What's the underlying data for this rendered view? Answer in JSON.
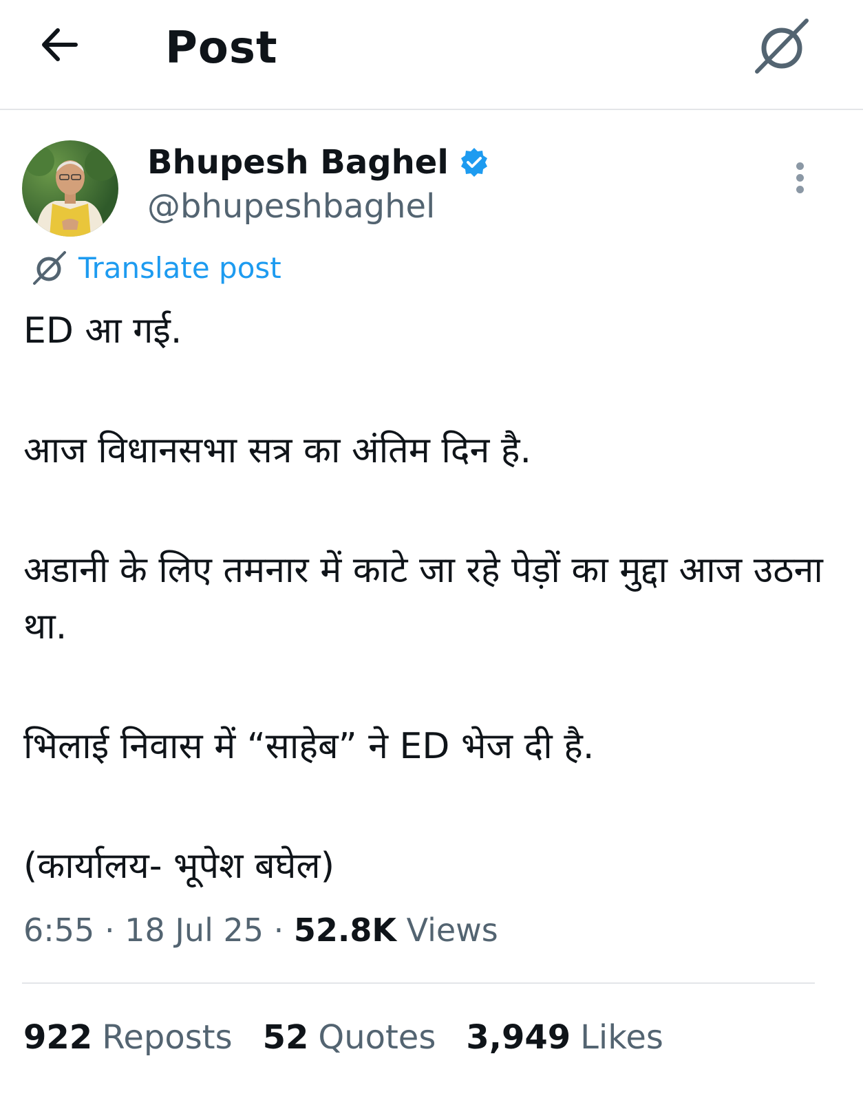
{
  "header": {
    "title": "Post",
    "back_icon": "arrow-left-icon",
    "translate_icon": "translate-icon"
  },
  "author": {
    "name": "Bhupesh Baghel",
    "handle": "@bhupeshbaghel",
    "verified": true,
    "verified_color": "#1d9bf0"
  },
  "translate": {
    "label": "Translate post",
    "color": "#1d9bf0"
  },
  "post": {
    "paragraphs": [
      "ED आ गई.",
      "आज विधानसभा सत्र का अंतिम दिन है.",
      "अडानी के लिए तमनार में काटे जा रहे पेड़ों का मुद्दा आज उठना था.",
      "भिलाई निवास में “साहेब” ने ED भेज दी है.",
      "(कार्यालय- भूपेश बघेल)"
    ]
  },
  "meta": {
    "time": "6:55",
    "separator": "·",
    "date": "18 Jul 25",
    "views_count": "52.8K",
    "views_label": "Views"
  },
  "stats": {
    "reposts_count": "922",
    "reposts_label": "Reposts",
    "quotes_count": "52",
    "quotes_label": "Quotes",
    "likes_count": "3,949",
    "likes_label": "Likes"
  }
}
